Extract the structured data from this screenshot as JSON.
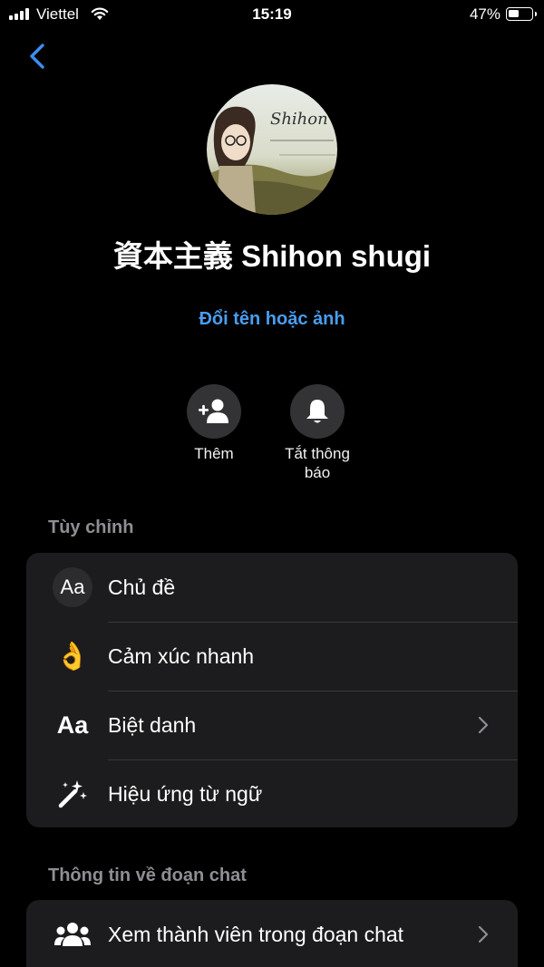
{
  "status_bar": {
    "carrier": "Viettel",
    "time": "15:19",
    "battery": "47%"
  },
  "profile": {
    "name": "資本主義 Shihon shugi",
    "change_link": "Đổi tên hoặc ảnh"
  },
  "avatar_text": "Shihon",
  "actions": {
    "add_label": "Thêm",
    "mute_label": "Tắt thông báo"
  },
  "customize": {
    "title": "Tùy chỉnh",
    "theme": {
      "icon_text": "Aa",
      "label": "Chủ đề"
    },
    "quick_reaction": {
      "icon_text": "👌",
      "label": "Cảm xúc nhanh"
    },
    "nicknames": {
      "icon_text": "Aa",
      "label": "Biệt danh"
    },
    "word_effects": {
      "label": "Hiệu ứng từ ngữ"
    }
  },
  "chat_info": {
    "title": "Thông tin về đoạn chat",
    "members": {
      "label": "Xem thành viên trong đoạn chat"
    }
  },
  "colors": {
    "accent": "#4a9df0",
    "background": "#000000",
    "card": "#1c1c1e",
    "secondary_text": "#8e8e93"
  }
}
